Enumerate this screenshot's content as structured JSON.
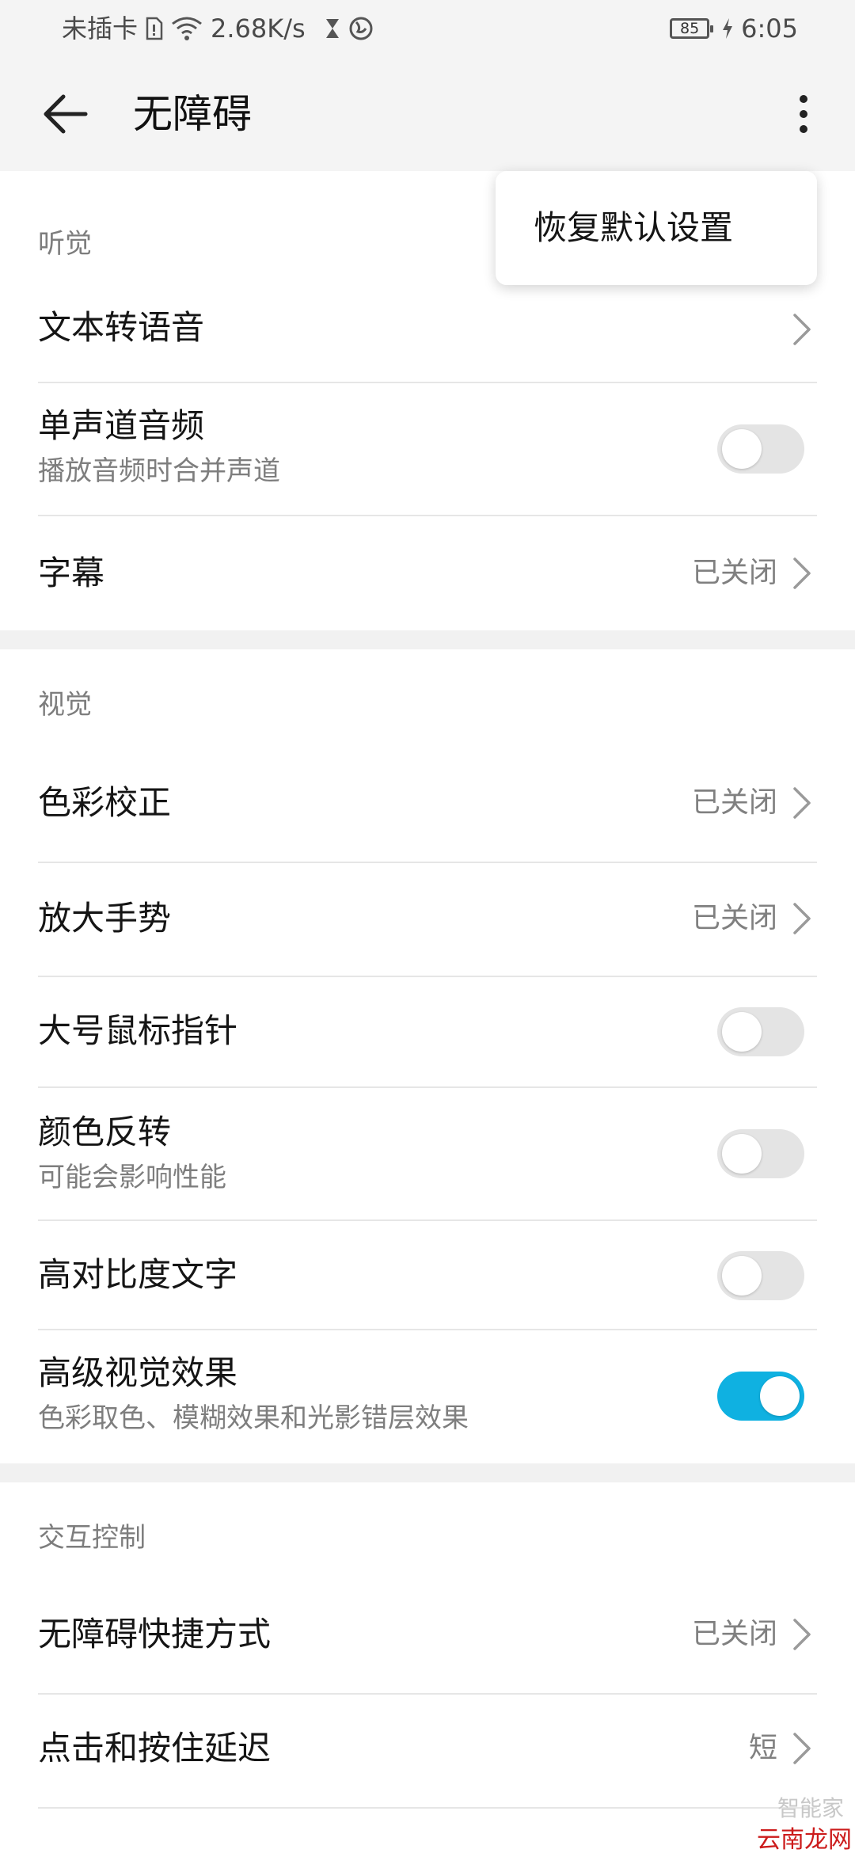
{
  "status_bar": {
    "carrier": "未插卡",
    "speed": "2.68K/s",
    "battery": "85",
    "time": "6:05"
  },
  "app_bar": {
    "title": "无障碍"
  },
  "popup_menu": {
    "item": "恢复默认设置"
  },
  "sections": {
    "hearing": {
      "header": "听觉",
      "tts": {
        "title": "文本转语音"
      },
      "mono": {
        "title": "单声道音频",
        "subtitle": "播放音频时合并声道",
        "enabled": false
      },
      "captions": {
        "title": "字幕",
        "value": "已关闭"
      }
    },
    "vision": {
      "header": "视觉",
      "color_correction": {
        "title": "色彩校正",
        "value": "已关闭"
      },
      "magnification": {
        "title": "放大手势",
        "value": "已关闭"
      },
      "large_pointer": {
        "title": "大号鼠标指针",
        "enabled": false
      },
      "color_inversion": {
        "title": "颜色反转",
        "subtitle": "可能会影响性能",
        "enabled": false
      },
      "high_contrast": {
        "title": "高对比度文字",
        "enabled": false
      },
      "advanced_visual": {
        "title": "高级视觉效果",
        "subtitle": "色彩取色、模糊效果和光影错层效果",
        "enabled": true
      }
    },
    "interaction": {
      "header": "交互控制",
      "shortcut": {
        "title": "无障碍快捷方式",
        "value": "已关闭"
      },
      "touch_delay": {
        "title": "点击和按住延迟",
        "value": "短"
      }
    }
  },
  "watermark": {
    "top": "智能家",
    "bottom": "云南龙网"
  },
  "colors": {
    "accent": "#0fb1e1",
    "background": "#f4f4f4",
    "watermark_red": "#cc1b1b"
  }
}
